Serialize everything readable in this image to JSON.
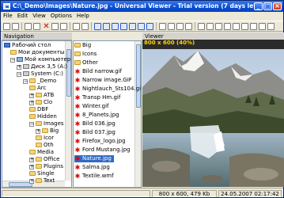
{
  "window": {
    "title": "C:\\_Demo\\Images\\Nature.jpg - Universal Viewer - Trial version (7 days left)"
  },
  "menu": [
    "File",
    "Edit",
    "View",
    "Options",
    "Help"
  ],
  "navigation": {
    "title": "Navigation",
    "tree": [
      {
        "label": "Рабочий стол",
        "icon": "desktop-icon",
        "depth": 0,
        "expander": ""
      },
      {
        "label": "Мои документы",
        "icon": "folder-icon",
        "depth": 1,
        "expander": ""
      },
      {
        "label": "Мой компьютер",
        "icon": "computer-icon",
        "depth": 1,
        "expander": "-"
      },
      {
        "label": "Диск 3,5 (A:)",
        "icon": "drive-icon",
        "depth": 2,
        "expander": "+"
      },
      {
        "label": "System (C:)",
        "icon": "drive-icon",
        "depth": 2,
        "expander": "-"
      },
      {
        "label": "_Demo",
        "icon": "folder-icon",
        "depth": 3,
        "expander": "-"
      },
      {
        "label": "Arc",
        "icon": "folder-icon",
        "depth": 4,
        "expander": ""
      },
      {
        "label": "ATB",
        "icon": "folder-icon",
        "depth": 4,
        "expander": "+"
      },
      {
        "label": "Clo",
        "icon": "folder-icon",
        "depth": 4,
        "expander": "+"
      },
      {
        "label": "DBF",
        "icon": "folder-icon",
        "depth": 4,
        "expander": ""
      },
      {
        "label": "Hidden",
        "icon": "folder-icon",
        "depth": 4,
        "expander": ""
      },
      {
        "label": "Images",
        "icon": "folder-icon",
        "depth": 4,
        "expander": "-"
      },
      {
        "label": "Big",
        "icon": "folder-icon",
        "depth": 5,
        "expander": "+"
      },
      {
        "label": "Icor",
        "icon": "folder-icon",
        "depth": 5,
        "expander": ""
      },
      {
        "label": "Oth",
        "icon": "folder-icon",
        "depth": 5,
        "expander": ""
      },
      {
        "label": "Media",
        "icon": "folder-icon",
        "depth": 4,
        "expander": ""
      },
      {
        "label": "Office",
        "icon": "folder-icon",
        "depth": 4,
        "expander": "+"
      },
      {
        "label": "Plugins",
        "icon": "folder-icon",
        "depth": 4,
        "expander": "+"
      },
      {
        "label": "Single",
        "icon": "folder-icon",
        "depth": 4,
        "expander": ""
      },
      {
        "label": "Text",
        "icon": "folder-icon",
        "depth": 4,
        "expander": "+"
      }
    ]
  },
  "files": [
    {
      "name": "Big",
      "icon": "folder-icon",
      "selected": false
    },
    {
      "name": "Icons",
      "icon": "folder-icon",
      "selected": false
    },
    {
      "name": "Other",
      "icon": "folder-icon",
      "selected": false
    },
    {
      "name": "Bild narrow.gif",
      "icon": "image-file-icon",
      "selected": false
    },
    {
      "name": "Narrow image.GIF",
      "icon": "image-file-icon",
      "selected": false
    },
    {
      "name": "Nightlauch_Sts104.gif",
      "icon": "image-file-icon",
      "selected": false
    },
    {
      "name": "Transp Hm.gif",
      "icon": "image-file-icon",
      "selected": false
    },
    {
      "name": "Winter.gif",
      "icon": "image-file-icon",
      "selected": false
    },
    {
      "name": "8_Planets.jpg",
      "icon": "image-file-icon",
      "selected": false
    },
    {
      "name": "Bild 036.jpg",
      "icon": "image-file-icon",
      "selected": false
    },
    {
      "name": "Bild 037.jpg",
      "icon": "image-file-icon",
      "selected": false
    },
    {
      "name": "Firefox_logo.jpg",
      "icon": "image-file-icon",
      "selected": false
    },
    {
      "name": "Ford Mustang.jpg",
      "icon": "image-file-icon",
      "selected": false
    },
    {
      "name": "Nature.jpg",
      "icon": "image-file-icon",
      "selected": true
    },
    {
      "name": "Salma.jpg",
      "icon": "image-file-icon",
      "selected": false
    },
    {
      "name": "Textile.wmf",
      "icon": "image-file-icon",
      "selected": false
    }
  ],
  "viewer": {
    "title": "Viewer",
    "dimensions": "800 x 600 (40%)"
  },
  "status": {
    "left": "",
    "middle": "800 x 600, 479 Kb",
    "right": "24.05.2007 02:17:42"
  },
  "colors": {
    "title_bar": "#0a4fd4",
    "selection": "#316ac5",
    "dimension_text": "#ffd400"
  }
}
